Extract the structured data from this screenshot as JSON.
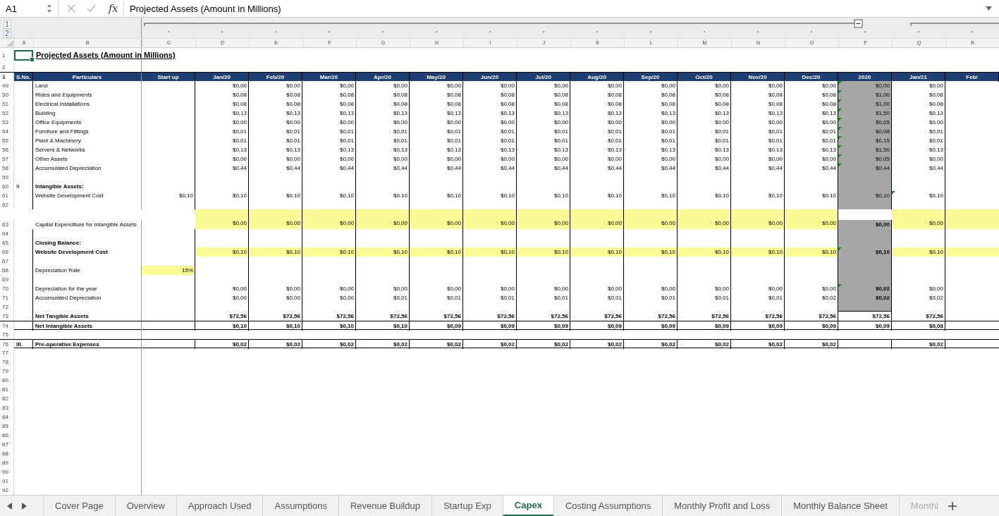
{
  "formula_bar": {
    "name_box": "A1",
    "fx": "fx",
    "formula": "Projected Assets (Amount in Millions)"
  },
  "outline": {
    "levels": [
      "1",
      "2"
    ]
  },
  "columns": [
    "A",
    "B",
    "C",
    "D",
    "E",
    "F",
    "G",
    "H",
    "I",
    "J",
    "K",
    "L",
    "M",
    "N",
    "O",
    "P",
    "Q",
    "R"
  ],
  "rows": [
    {
      "n": "1",
      "kind": "title",
      "label": "Projected Assets (Amount in Millions)"
    },
    {
      "n": "2",
      "kind": "blank"
    },
    {
      "n": "3",
      "kind": "header",
      "headers": [
        "S.No.",
        "Particulars",
        "Start up",
        "Jan/20",
        "Feb/20",
        "Mar/20",
        "Apr/20",
        "May/20",
        "Jun/20",
        "Jul/20",
        "Aug/20",
        "Sep/20",
        "Oct/20",
        "Nov/20",
        "Dec/20",
        "2020",
        "Jan/21",
        "Feb/"
      ]
    },
    {
      "n": "49",
      "kind": "data",
      "label": "Land",
      "total_shaded": true,
      "total_flag": true,
      "months": [
        "$0,00",
        "$0,00",
        "$0,00",
        "$0,00",
        "$0,00",
        "$0,00",
        "$0,00",
        "$0,00",
        "$0,00",
        "$0,00",
        "$0,00",
        "$0,00"
      ],
      "total": "$0,00",
      "next": "$0,00"
    },
    {
      "n": "50",
      "kind": "data",
      "label": "Rides and Equipments",
      "total_shaded": true,
      "total_flag": true,
      "months": [
        "$0,08",
        "$0,08",
        "$0,08",
        "$0,08",
        "$0,08",
        "$0,08",
        "$0,08",
        "$0,08",
        "$0,08",
        "$0,08",
        "$0,08",
        "$0,08"
      ],
      "total": "$1,00",
      "next": "$0,08"
    },
    {
      "n": "51",
      "kind": "data",
      "label": "Electrical Installations",
      "total_shaded": true,
      "total_flag": true,
      "months": [
        "$0,08",
        "$0,08",
        "$0,08",
        "$0,08",
        "$0,08",
        "$0,08",
        "$0,08",
        "$0,08",
        "$0,08",
        "$0,08",
        "$0,08",
        "$0,08"
      ],
      "total": "$1,00",
      "next": "$0,08"
    },
    {
      "n": "52",
      "kind": "data",
      "label": "Building",
      "total_shaded": true,
      "total_flag": true,
      "months": [
        "$0,13",
        "$0,13",
        "$0,13",
        "$0,13",
        "$0,13",
        "$0,13",
        "$0,13",
        "$0,13",
        "$0,13",
        "$0,13",
        "$0,13",
        "$0,13"
      ],
      "total": "$1,50",
      "next": "$0,13"
    },
    {
      "n": "53",
      "kind": "data",
      "label": "Office Equipments",
      "total_shaded": true,
      "total_flag": true,
      "months": [
        "$0,00",
        "$0,00",
        "$0,00",
        "$0,00",
        "$0,00",
        "$0,00",
        "$0,00",
        "$0,00",
        "$0,00",
        "$0,00",
        "$0,00",
        "$0,00"
      ],
      "total": "$0,05",
      "next": "$0,00"
    },
    {
      "n": "54",
      "kind": "data",
      "label": "Furniture and Fittings",
      "total_shaded": true,
      "total_flag": true,
      "months": [
        "$0,01",
        "$0,01",
        "$0,01",
        "$0,01",
        "$0,01",
        "$0,01",
        "$0,01",
        "$0,01",
        "$0,01",
        "$0,01",
        "$0,01",
        "$0,01"
      ],
      "total": "$0,08",
      "next": "$0,01"
    },
    {
      "n": "55",
      "kind": "data",
      "label": "Plant & Machinery",
      "total_shaded": true,
      "total_flag": true,
      "months": [
        "$0,01",
        "$0,01",
        "$0,01",
        "$0,01",
        "$0,01",
        "$0,01",
        "$0,01",
        "$0,01",
        "$0,01",
        "$0,01",
        "$0,01",
        "$0,01"
      ],
      "total": "$0,15",
      "next": "$0,01"
    },
    {
      "n": "56",
      "kind": "data",
      "label": "Servers & Networks",
      "total_shaded": true,
      "total_flag": true,
      "months": [
        "$0,13",
        "$0,13",
        "$0,13",
        "$0,13",
        "$0,13",
        "$0,13",
        "$0,13",
        "$0,13",
        "$0,13",
        "$0,13",
        "$0,13",
        "$0,13"
      ],
      "total": "$1,50",
      "next": "$0,13"
    },
    {
      "n": "57",
      "kind": "data",
      "label": "Other Assets",
      "total_shaded": true,
      "total_flag": true,
      "months": [
        "$0,00",
        "$0,00",
        "$0,00",
        "$0,00",
        "$0,00",
        "$0,00",
        "$0,00",
        "$0,00",
        "$0,00",
        "$0,00",
        "$0,00",
        "$0,00"
      ],
      "total": "$0,05",
      "next": "$0,00"
    },
    {
      "n": "58",
      "kind": "data",
      "label": "Accumulated Depreciation",
      "total_shaded": true,
      "total_flag": true,
      "months": [
        "$0,44",
        "$0,44",
        "$0,44",
        "$0,44",
        "$0,44",
        "$0,44",
        "$0,44",
        "$0,44",
        "$0,44",
        "$0,44",
        "$0,44",
        "$0,44"
      ],
      "total": "$0,44",
      "next": "$0,44"
    },
    {
      "n": "59",
      "kind": "data",
      "total_shaded": true
    },
    {
      "n": "60",
      "kind": "data",
      "sno": "II",
      "label": "Intangible Assets:",
      "label_bold": true,
      "total_shaded": true
    },
    {
      "n": "61",
      "kind": "data",
      "label": "Website Development Cost",
      "total_shaded": true,
      "next_flag": true,
      "start_up": "$0,10",
      "months": [
        "$0,10",
        "$0,10",
        "$0,10",
        "$0,10",
        "$0,10",
        "$0,10",
        "$0,10",
        "$0,10",
        "$0,10",
        "$0,10",
        "$0,10",
        "$0,10"
      ],
      "total": "$0,10",
      "next": "$0,10"
    },
    {
      "n": "62",
      "kind": "data",
      "total_shaded": true
    },
    {
      "n": "63",
      "kind": "data",
      "tall": true,
      "highlighted": true,
      "label": "Capital Expenditure for intangible Assets",
      "total_shaded": true,
      "total_bold": true,
      "months": [
        "$0,00",
        "$0,00",
        "$0,00",
        "$0,00",
        "$0,00",
        "$0,00",
        "$0,00",
        "$0,00",
        "$0,00",
        "$0,00",
        "$0,00",
        "$0,00"
      ],
      "total": "$0,00",
      "next": "$0,00"
    },
    {
      "n": "64",
      "kind": "data",
      "total_shaded": true
    },
    {
      "n": "65",
      "kind": "data",
      "label": "Closing Balance:",
      "label_bold": true,
      "total_shaded": true
    },
    {
      "n": "66",
      "kind": "data",
      "highlighted": true,
      "label": "Website Development Cost",
      "label_bold": true,
      "total_shaded": true,
      "total_bold": true,
      "total_flag": true,
      "months": [
        "$0,10",
        "$0,10",
        "$0,10",
        "$0,10",
        "$0,10",
        "$0,10",
        "$0,10",
        "$0,10",
        "$0,10",
        "$0,10",
        "$0,10",
        "$0,10"
      ],
      "total": "$0,10",
      "next": "$0,10"
    },
    {
      "n": "67",
      "kind": "data",
      "total_shaded": true
    },
    {
      "n": "68",
      "kind": "data",
      "start_up_highlighted": true,
      "label": "Depreciation Rate",
      "total_shaded": true,
      "start_up": "15%"
    },
    {
      "n": "69",
      "kind": "data",
      "total_shaded": true
    },
    {
      "n": "70",
      "kind": "data",
      "label": "Depreciation for the year",
      "total_shaded": true,
      "total_bold": true,
      "total_flag": true,
      "months": [
        "$0,00",
        "$0,00",
        "$0,00",
        "$0,00",
        "$0,00",
        "$0,00",
        "$0,00",
        "$0,00",
        "$0,00",
        "$0,00",
        "$0,00",
        "$0,00"
      ],
      "total": "$0,02",
      "next": "$0,00"
    },
    {
      "n": "71",
      "kind": "data",
      "label": "Accumulated Depreciation",
      "total_shaded": true,
      "total_bold": true,
      "months": [
        "$0,00",
        "$0,00",
        "$0,00",
        "$0,01",
        "$0,01",
        "$0,01",
        "$0,01",
        "$0,01",
        "$0,01",
        "$0,01",
        "$0,01",
        "$0,02"
      ],
      "total": "$0,02",
      "next": "$0,02"
    },
    {
      "n": "72",
      "kind": "data",
      "total_shaded": true
    },
    {
      "n": "73",
      "kind": "data",
      "label": "Net Tangible Assets",
      "bold": true,
      "months": [
        "$72,56",
        "$72,56",
        "$72,56",
        "$72,56",
        "$72,56",
        "$72,56",
        "$72,56",
        "$72,56",
        "$72,56",
        "$72,56",
        "$72,56",
        "$72,56"
      ],
      "total": "$72,56",
      "next": "$72,56"
    },
    {
      "n": "74",
      "kind": "data",
      "boxed": true,
      "label": "Net Intangible Assets",
      "bold": true,
      "months": [
        "$0,10",
        "$0,10",
        "$0,10",
        "$0,10",
        "$0,09",
        "$0,09",
        "$0,09",
        "$0,09",
        "$0,09",
        "$0,09",
        "$0,09",
        "$0,09"
      ],
      "total": "$0,09",
      "next": "$0,08"
    },
    {
      "n": "75",
      "kind": "gap"
    },
    {
      "n": "76",
      "kind": "data",
      "boxed": true,
      "sno": "III.",
      "label": "Pre-operative Expenses",
      "bold": true,
      "months": [
        "$0,02",
        "$0,02",
        "$0,02",
        "$0,02",
        "$0,02",
        "$0,02",
        "$0,02",
        "$0,02",
        "$0,02",
        "$0,02",
        "$0,02",
        "$0,02"
      ],
      "next": "$0,02"
    },
    {
      "n": "77",
      "kind": "empty"
    },
    {
      "n": "78",
      "kind": "empty"
    },
    {
      "n": "79",
      "kind": "empty"
    },
    {
      "n": "80",
      "kind": "empty"
    },
    {
      "n": "81",
      "kind": "empty"
    },
    {
      "n": "82",
      "kind": "empty"
    },
    {
      "n": "83",
      "kind": "empty"
    },
    {
      "n": "84",
      "kind": "empty"
    },
    {
      "n": "85",
      "kind": "empty"
    },
    {
      "n": "86",
      "kind": "empty"
    },
    {
      "n": "87",
      "kind": "empty"
    },
    {
      "n": "88",
      "kind": "empty"
    },
    {
      "n": "89",
      "kind": "empty"
    },
    {
      "n": "90",
      "kind": "empty"
    },
    {
      "n": "91",
      "kind": "empty"
    },
    {
      "n": "92",
      "kind": "empty"
    }
  ],
  "sheet_tabs": [
    {
      "label": "Cover Page",
      "selected": false
    },
    {
      "label": "Overview",
      "selected": false
    },
    {
      "label": "Approach Used",
      "selected": false
    },
    {
      "label": "Assumptions",
      "selected": false
    },
    {
      "label": "Revenue Buildup",
      "selected": false
    },
    {
      "label": "Startup Exp",
      "selected": false
    },
    {
      "label": "Capex",
      "selected": true
    },
    {
      "label": "Costing Assumptions",
      "selected": false
    },
    {
      "label": "Monthly Profit and Loss",
      "selected": false
    },
    {
      "label": "Monthly Balance Sheet",
      "selected": false
    },
    {
      "label": "Monthl",
      "selected": false
    }
  ]
}
